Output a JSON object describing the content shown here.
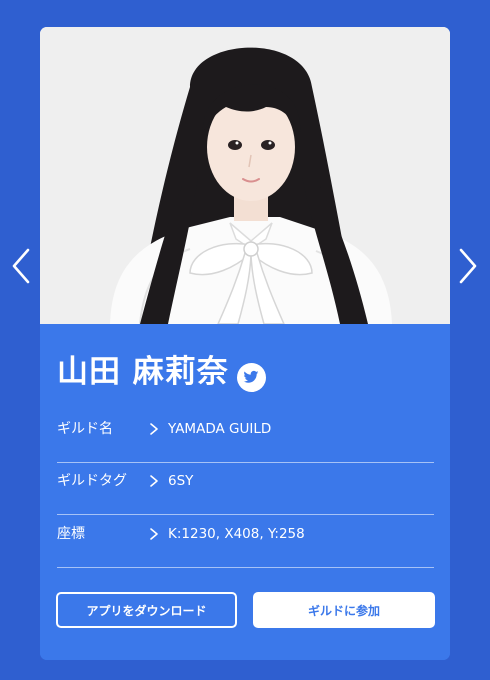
{
  "nav": {
    "prev_icon": "chevron-left-icon",
    "next_icon": "chevron-right-icon"
  },
  "member": {
    "name": "山田 麻莉奈",
    "social_icon": "twitter-bird-icon",
    "photo_alt": "member portrait photo"
  },
  "details": [
    {
      "label": "ギルド名",
      "value": "YAMADA GUILD"
    },
    {
      "label": "ギルドタグ",
      "value": "6SY"
    },
    {
      "label": "座標",
      "value": "K:1230, X408, Y:258"
    }
  ],
  "actions": {
    "download_label": "アプリをダウンロード",
    "join_label": "ギルドに参加"
  },
  "colors": {
    "background": "#2f5fd0",
    "card": "#3b78ea",
    "text": "#ffffff",
    "join_text": "#3b78ea"
  }
}
